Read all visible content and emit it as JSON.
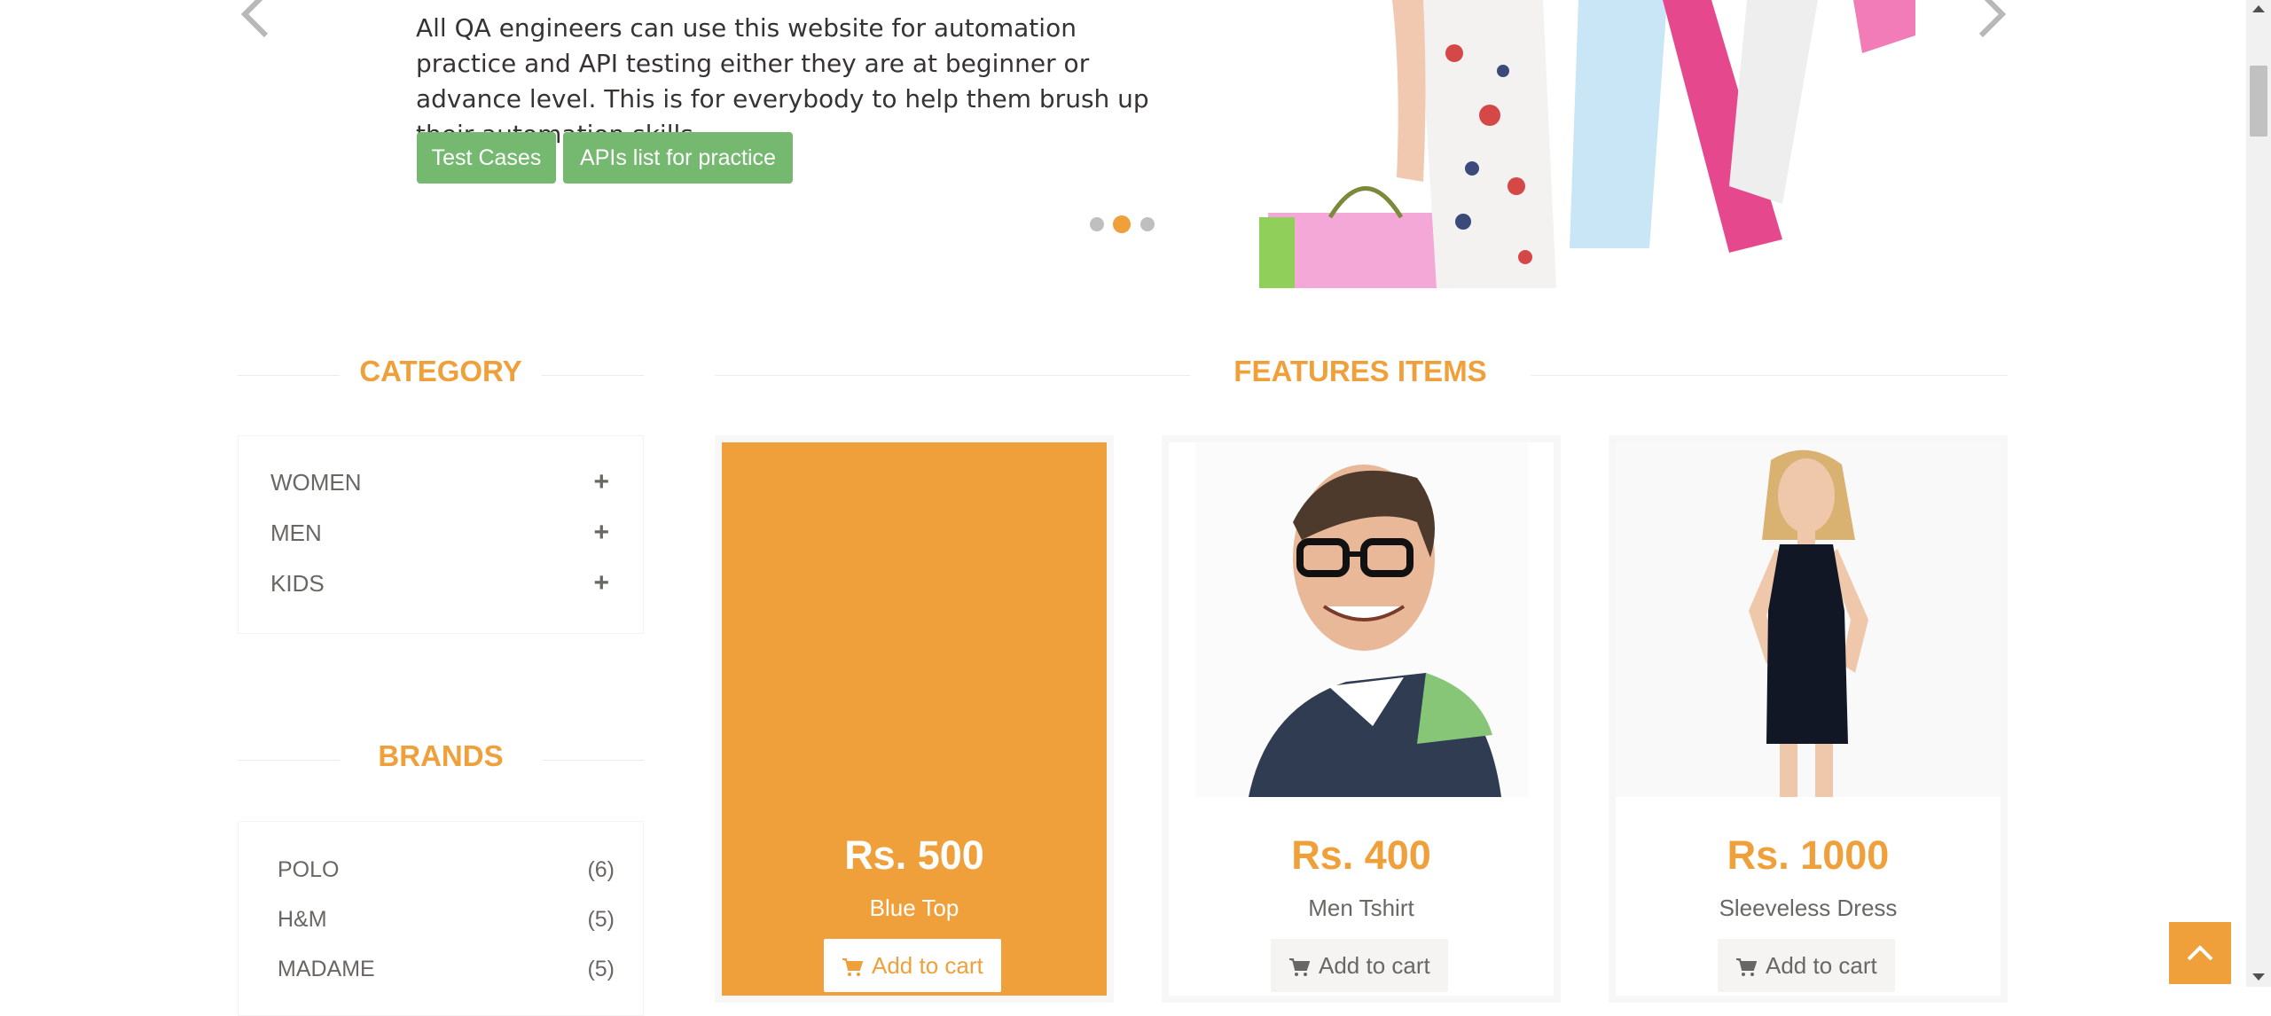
{
  "slider": {
    "description": "All QA engineers can use this website for automation practice and API testing either they are at beginner or advance level. This is for everybody to help them brush up their automation skills.",
    "buttons": [
      "Test Cases",
      "APIs list for practice"
    ],
    "active_slide": 2,
    "slide_count": 3
  },
  "category": {
    "title": "CATEGORY",
    "items": [
      {
        "label": "WOMEN",
        "toggle": "+"
      },
      {
        "label": "MEN",
        "toggle": "+"
      },
      {
        "label": "KIDS",
        "toggle": "+"
      }
    ]
  },
  "brands": {
    "title": "BRANDS",
    "items": [
      {
        "label": "POLO",
        "count": "(6)"
      },
      {
        "label": "H&M",
        "count": "(5)"
      },
      {
        "label": "MADAME",
        "count": "(5)"
      }
    ]
  },
  "features": {
    "title": "FEATURES ITEMS",
    "products": [
      {
        "price": "Rs. 500",
        "name": "Blue Top",
        "button": "Add to cart",
        "hovered": true
      },
      {
        "price": "Rs. 400",
        "name": "Men Tshirt",
        "button": "Add to cart",
        "hovered": false
      },
      {
        "price": "Rs. 1000",
        "name": "Sleeveless Dress",
        "button": "Add to cart",
        "hovered": false
      }
    ]
  },
  "colors": {
    "accent": "#f0a03a",
    "button_green": "#74b96f",
    "text": "#696763"
  }
}
